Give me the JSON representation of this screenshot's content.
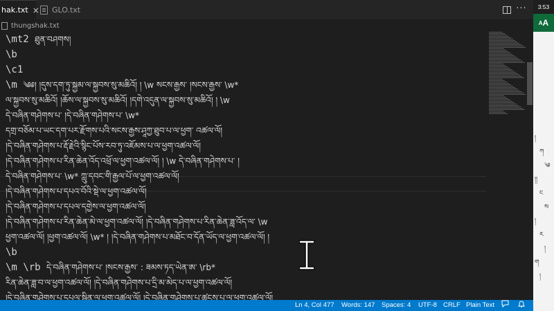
{
  "tabs": [
    {
      "label": "hak.txt",
      "active": true,
      "close": "×"
    },
    {
      "label": "GLO.txt",
      "active": false
    }
  ],
  "toolbar": {
    "split_icon": "split-editor-icon",
    "more_icon": "more-actions-icon",
    "more_label": "···"
  },
  "breadcrumb": {
    "file": "thungshak.txt"
  },
  "lines": [
    {
      "cmd": "\\mt2 ",
      "tib": "ཐུན་བཤགས།"
    },
    {
      "cmd": "\\b",
      "tib": ""
    },
    {
      "cmd": "\\c1",
      "tib": ""
    },
    {
      "cmd": "\\m ",
      "tib": "༄༅། །དུས་དག་ཏུ་སྐྱམ་ལ་སྐྱབས་སུ་མཆིའོ། ། \\w  སངས་རྒྱས་ །སངས་རྒྱས་ \\w*"
    },
    {
      "cmd": "",
      "tib": "ལ་སྐྱབས་སུ་མཆིའོ། །ཆོས་ལ་སྐྱབས་སུ་མཆིའོ། །དགེ་འདུན་ལ་སྐྱབས་སུ་མཆིའོ། ། \\w"
    },
    {
      "cmd": "",
      "tib": "དེ་བཞིན་གཤེགས་པ་ །དེ་བཞིན་གཤེགས་པ་ \\w*"
    },
    {
      "cmd": "",
      "tib": "དགྲ་བཅོམ་པ་ཡང་དག་པར་རྫོགས་པའི་སངས་རྒྱས་ཤཱཀྱ་ཐུབ་པ་ལ་ཕྱག་ འཚལ་ལོ།"
    },
    {
      "cmd": "",
      "tib": "།དེ་བཞིན་གཤེགས་པ་རྡོ་རྗེའི་སྙིང་པོས་རབ་ཏུ་འཇོམས་པ་ལ་ཕྱག་འཚལ་ལོ།"
    },
    {
      "cmd": "",
      "tib": "།དེ་བཞིན་གཤེགས་པ་རིན་ཆེན་འོད་འཕྲོ་ལ་ཕྱག་འཚལ་ལོ། ། \\w  དེ་བཞིན་གཤེགས་པ་ །"
    },
    {
      "cmd": "",
      "tib": "དེ་བཞིན་གཤེགས་པ་ \\w*  ཀླུ་དབང་གི་རྒྱལ་པོ་ལ་ཕྱག་འཚལ་ལོ།"
    },
    {
      "cmd": "",
      "tib": "།དེ་བཞིན་གཤེགས་པ་དཔའ་བོའི་སྡེ་ལ་ཕྱག་འཚལ་ལོ།"
    },
    {
      "cmd": "",
      "tib": "།དེ་བཞིན་གཤེགས་པ་དཔལ་དགྱེས་ལ་ཕྱག་འཚལ་ལོ།"
    },
    {
      "cmd": "",
      "tib": "།དེ་བཞིན་གཤེགས་པ་རིན་ཆེན་མེ་ལ་ཕྱག་འཚལ་ལོ། །དེ་བཞིན་གཤེགས་པ་རིན་ཆེན་ཟླ་འོད་ལ་ \\w"
    },
    {
      "cmd": "",
      "tib": "ཕྱག་འཚལ་ལོ། །ཕྱག་འཚལ་ལོ། \\w* ། །དེ་བཞིན་གཤེགས་པ་མཐོང་བ་དོན་ཡོད་ལ་ཕྱག་འཚལ་ལོ། །"
    },
    {
      "cmd": "\\b",
      "tib": ""
    },
    {
      "cmd": "\\m \\rb ",
      "tib": "དེ་བཞིན་གཤེགས་པ་ །སངས་རྒྱས་  :  ཟམས་ཏད་ཡེན་ཨ་ \\rb*"
    },
    {
      "cmd": "",
      "tib": "རིན་ཆེན་ཟླ་བ་ལ་ཕྱག་འཚལ་ལོ། །དེ་བཞིན་གཤེགས་པ་དྲི་མ་མེད་པ་ལ་ཕྱག་འཚལ་ལོ།"
    },
    {
      "cmd": "",
      "tib": "།དེ་བཞིན་གཤེགས་པ་དཔལ་སྦྱིན་ལ་ཕྱག་འཚལ་ལོ། །དེ་བཞིན་གཤེགས་པ་ཚངས་པ་ལ་ཕྱག་འཚལ་ལོ།"
    },
    {
      "cmd": "",
      "tib": "།དེ་བཞིན་གཤེགས་པ་ཚངས་པས་སྦྱིན་ལ་ཕྱག་འཚལ་ལོ། །དེ་བཞིན་གཤེགས་པ་ཆུ་ལྷ་ལ་ཕྱག་འཚལ་ལོ།"
    }
  ],
  "statusbar": {
    "position": "Ln 4, Col 477",
    "words": "Words: 147",
    "spaces": "Spaces: 4",
    "encoding": "UTF-8",
    "eol": "CRLF",
    "language": "Plain Text",
    "feedback_icon": "feedback-icon",
    "bell_icon": "notifications-bell-icon"
  },
  "side_panel": {
    "time": "3:53",
    "font_button": "A",
    "font_button_small": "A"
  },
  "colors": {
    "editor_bg": "#1e1e1e",
    "statusbar_bg": "#007acc",
    "side_accent": "#0f6b3a"
  }
}
